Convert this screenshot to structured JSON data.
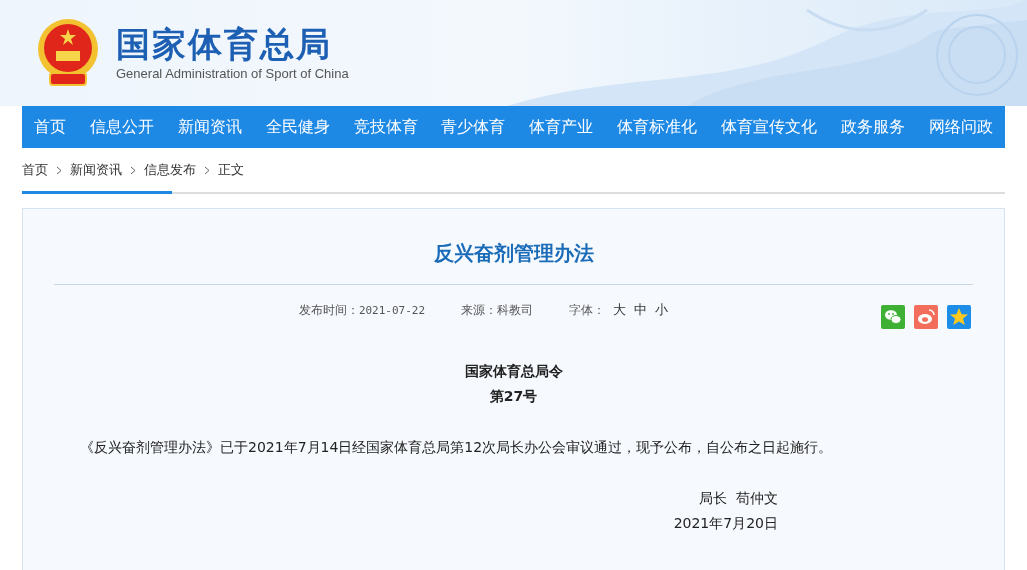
{
  "header": {
    "title": "国家体育总局",
    "subtitle": "General Administration of Sport of China"
  },
  "nav": [
    "首页",
    "信息公开",
    "新闻资讯",
    "全民健身",
    "竞技体育",
    "青少体育",
    "体育产业",
    "体育标准化",
    "体育宣传文化",
    "政务服务",
    "网络问政"
  ],
  "breadcrumb": [
    "首页",
    "新闻资讯",
    "信息发布",
    "正文"
  ],
  "article": {
    "title": "反兴奋剂管理办法",
    "meta": {
      "date_label": "发布时间：",
      "date": "2021-07-22",
      "source_label": "来源：",
      "source": "科教司",
      "font_label": "字体：",
      "font_sizes": [
        "大",
        "中",
        "小"
      ]
    },
    "share": [
      {
        "kind": "wechat"
      },
      {
        "kind": "weibo"
      },
      {
        "kind": "qzone"
      }
    ],
    "order_title": "国家体育总局令",
    "order_number": "第27号",
    "body": "《反兴奋剂管理办法》已于2021年7月14日经国家体育总局第12次局长办公会审议通过，现予公布，自公布之日起施行。",
    "signature": "局长  苟仲文",
    "signed_date": "2021年7月20日"
  }
}
